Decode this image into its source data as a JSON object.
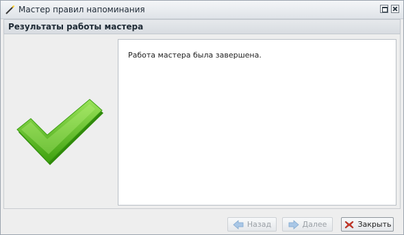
{
  "window": {
    "title": "Мастер правил напоминания",
    "icons": {
      "app": "magic-wand-icon",
      "maximize": "maximize-icon",
      "close": "close-icon"
    }
  },
  "header": {
    "label": "Результаты работы мастера"
  },
  "content": {
    "message": "Работа мастера была завершена.",
    "status_icon": "checkmark-icon"
  },
  "footer": {
    "back_label": "Назад",
    "next_label": "Далее",
    "close_label": "Закрыть",
    "back_enabled": false,
    "next_enabled": false
  },
  "colors": {
    "check_green": "#5bbf1a",
    "arrow_blue": "#6aa0d6",
    "close_red": "#d23b2c"
  }
}
